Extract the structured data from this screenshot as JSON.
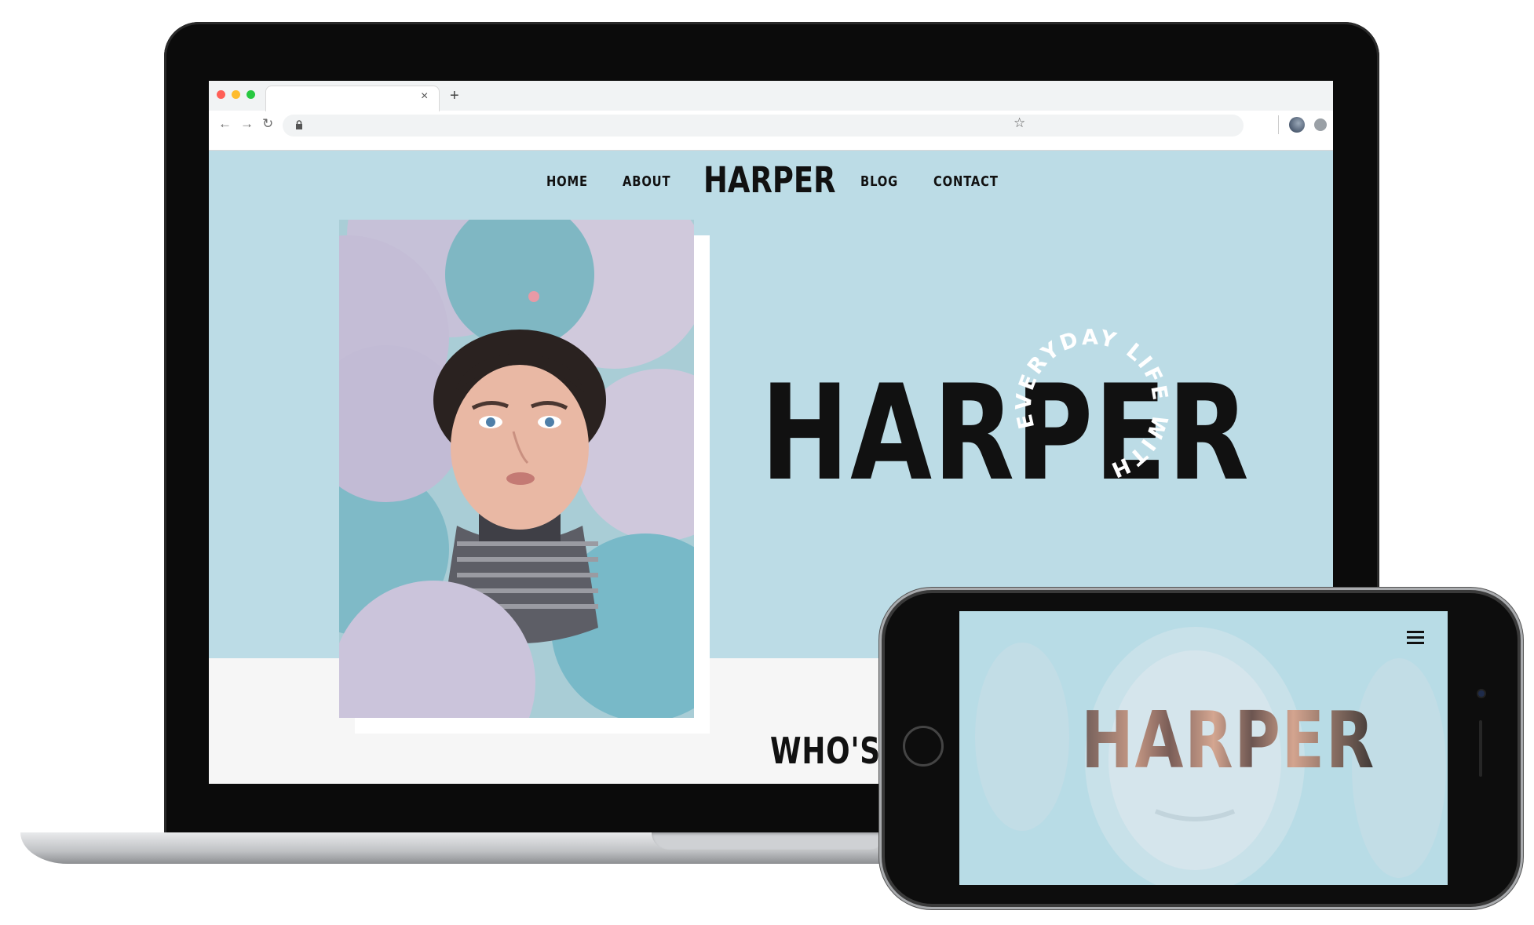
{
  "browser": {
    "tab_close": "×",
    "new_tab": "+",
    "back_icon": "←",
    "forward_icon": "→",
    "reload_icon": "↻",
    "bookmark_icon": "☆"
  },
  "site": {
    "nav": {
      "home": "HOME",
      "about": "ABOUT",
      "logo": "HARPER",
      "blog": "BLOG",
      "contact": "CONTACT"
    },
    "hero": {
      "title": "HARPER",
      "arc_text": "EVERYDAY LIFE WITH"
    },
    "section_heading": "WHO'S H"
  },
  "phone": {
    "title": "HARPER",
    "menu_icon": "hamburger-menu-icon"
  },
  "colors": {
    "page_bg": "#bcdce6",
    "text": "#111111",
    "lower_bg": "#f6f6f6"
  }
}
